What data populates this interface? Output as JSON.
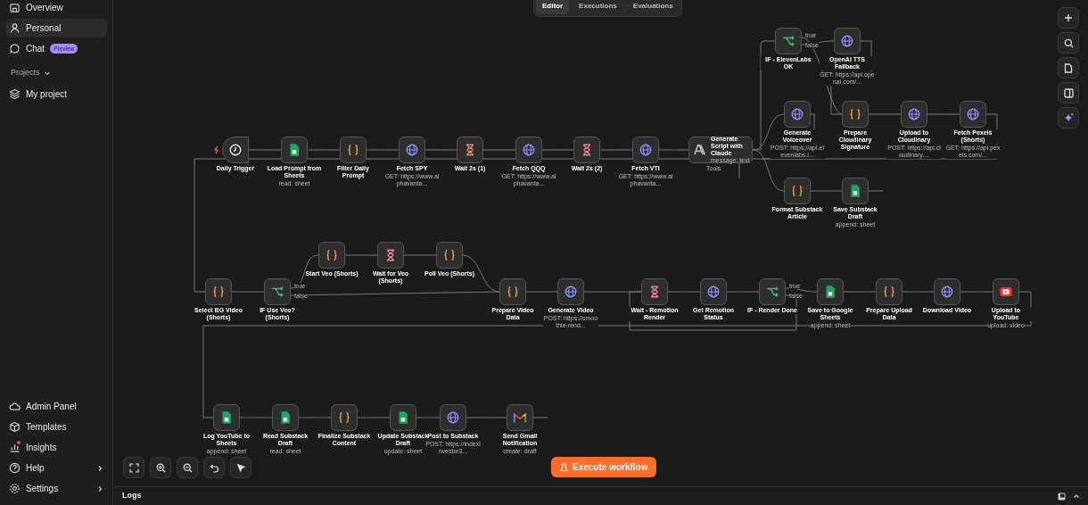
{
  "sidebar": {
    "items_top": [
      {
        "label": "Overview",
        "selected": false
      },
      {
        "label": "Personal",
        "selected": true
      },
      {
        "label": "Chat",
        "badge": "Preview",
        "selected": false
      }
    ],
    "projects_heading": "Projects",
    "projects": [
      {
        "label": "My project",
        "selected": false
      }
    ],
    "items_bottom": [
      {
        "label": "Admin Panel",
        "notification": false,
        "has_submenu": false
      },
      {
        "label": "Templates",
        "notification": false,
        "has_submenu": false
      },
      {
        "label": "Insights",
        "notification": true,
        "has_submenu": false
      },
      {
        "label": "Help",
        "notification": false,
        "has_submenu": true
      },
      {
        "label": "Settings",
        "notification": false,
        "has_submenu": true
      }
    ]
  },
  "tabs": [
    {
      "label": "Editor",
      "selected": true
    },
    {
      "label": "Executions",
      "selected": false
    },
    {
      "label": "Evaluations",
      "selected": false
    }
  ],
  "nodes": [
    {
      "kind": "trigger",
      "name": "Daily Trigger"
    },
    {
      "kind": "sheets",
      "name": "Load Prompt from Sheets",
      "subtitle": "read: sheet"
    },
    {
      "kind": "code",
      "name": "Filter Daily Prompt"
    },
    {
      "kind": "http",
      "name": "Fetch SPY",
      "subtitle": "GET: https://www.alphavanta..."
    },
    {
      "kind": "wait",
      "name": "Wait 2s (1)"
    },
    {
      "kind": "http",
      "name": "Fetch QQQ",
      "subtitle": "GET: https://www.alphavanta..."
    },
    {
      "kind": "wait",
      "name": "Wait 2s (2)"
    },
    {
      "kind": "http",
      "name": "Fetch VTI",
      "subtitle": "GET: https://www.alphavanta..."
    },
    {
      "kind": "ai",
      "name": "Generate Script with Claude",
      "subtitle": "message: text",
      "port_label": "Tools"
    },
    {
      "kind": "if",
      "name": "IF - ElevenLabs OK",
      "outputs": [
        "true",
        "false"
      ]
    },
    {
      "kind": "http",
      "name": "OpenAI TTS Fallback",
      "subtitle": "GET: https://api.openai.com/..."
    },
    {
      "kind": "http",
      "name": "Generate Voiceover",
      "subtitle": "POST: https://api.elevenlabs.i..."
    },
    {
      "kind": "code",
      "name": "Prepare Cloudinary Signature"
    },
    {
      "kind": "http",
      "name": "Upload to Cloudinary",
      "subtitle": "POST: https://api.cloudinary...."
    },
    {
      "kind": "http",
      "name": "Fetch Pexels (Shorts)",
      "subtitle": "GET: https://api.pexels.com/..."
    },
    {
      "kind": "code",
      "name": "Format Substack Article"
    },
    {
      "kind": "sheets",
      "name": "Save Substack Draft",
      "subtitle": "append: sheet"
    },
    {
      "kind": "code",
      "name": "Select BG Video (Shorts)"
    },
    {
      "kind": "if",
      "name": "IF Use Veo? (Shorts)",
      "outputs": [
        "true",
        "false"
      ]
    },
    {
      "kind": "code",
      "name": "Start Veo (Shorts)"
    },
    {
      "kind": "wait",
      "name": "Wait for Veo (Shorts)"
    },
    {
      "kind": "code",
      "name": "Poll Veo (Shorts)"
    },
    {
      "kind": "code",
      "name": "Prepare Video Data"
    },
    {
      "kind": "http",
      "name": "Generate Video",
      "subtitle": "POST: https://smoothie-rend..."
    },
    {
      "kind": "wait",
      "name": "Wait - Remotion Render"
    },
    {
      "kind": "http",
      "name": "Get Remotion Status"
    },
    {
      "kind": "if",
      "name": "IF - Render Done",
      "outputs": [
        "true",
        "false"
      ]
    },
    {
      "kind": "sheets",
      "name": "Save to Google Sheets",
      "subtitle": "append: sheet"
    },
    {
      "kind": "code",
      "name": "Prepare Upload Data"
    },
    {
      "kind": "http",
      "name": "Download Video"
    },
    {
      "kind": "youtube",
      "name": "Upload to YouTube",
      "subtitle": "upload: video"
    },
    {
      "kind": "sheets",
      "name": "Log YouTube to Sheets",
      "subtitle": "append: sheet"
    },
    {
      "kind": "sheets",
      "name": "Read Substack Draft",
      "subtitle": "read: sheet"
    },
    {
      "kind": "code",
      "name": "Finalize Substack Content"
    },
    {
      "kind": "sheets",
      "name": "Update Substack Draft",
      "subtitle": "update: sheet"
    },
    {
      "kind": "http",
      "name": "Post to Substack",
      "subtitle": "POST: https://indexinvestor3..."
    },
    {
      "kind": "gmail",
      "name": "Send Gmail Notification",
      "subtitle": "create: draft"
    }
  ],
  "execute_button": "Execute workflow",
  "logs_panel": {
    "title": "Logs"
  }
}
